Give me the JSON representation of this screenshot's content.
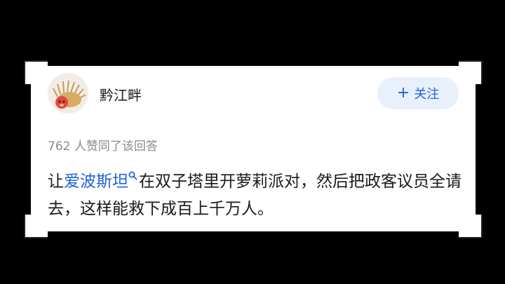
{
  "answer": {
    "author": {
      "name": "黔江畔",
      "avatar_icon": "hedgehog-avatar-icon"
    },
    "follow_button": {
      "label": "关注",
      "icon": "plus-icon",
      "background": "#e8f0fc",
      "color": "#1f63d6"
    },
    "likes_text": "762 人赞同了该回答",
    "content": {
      "prefix": "让",
      "link_text": "爱波斯坦",
      "link_icon": "search-icon",
      "link_color": "#1f63d6",
      "rest": "在双子塔里开萝莉派对，然后把政客议员全请去，这样能救下成百上千万人。"
    }
  }
}
